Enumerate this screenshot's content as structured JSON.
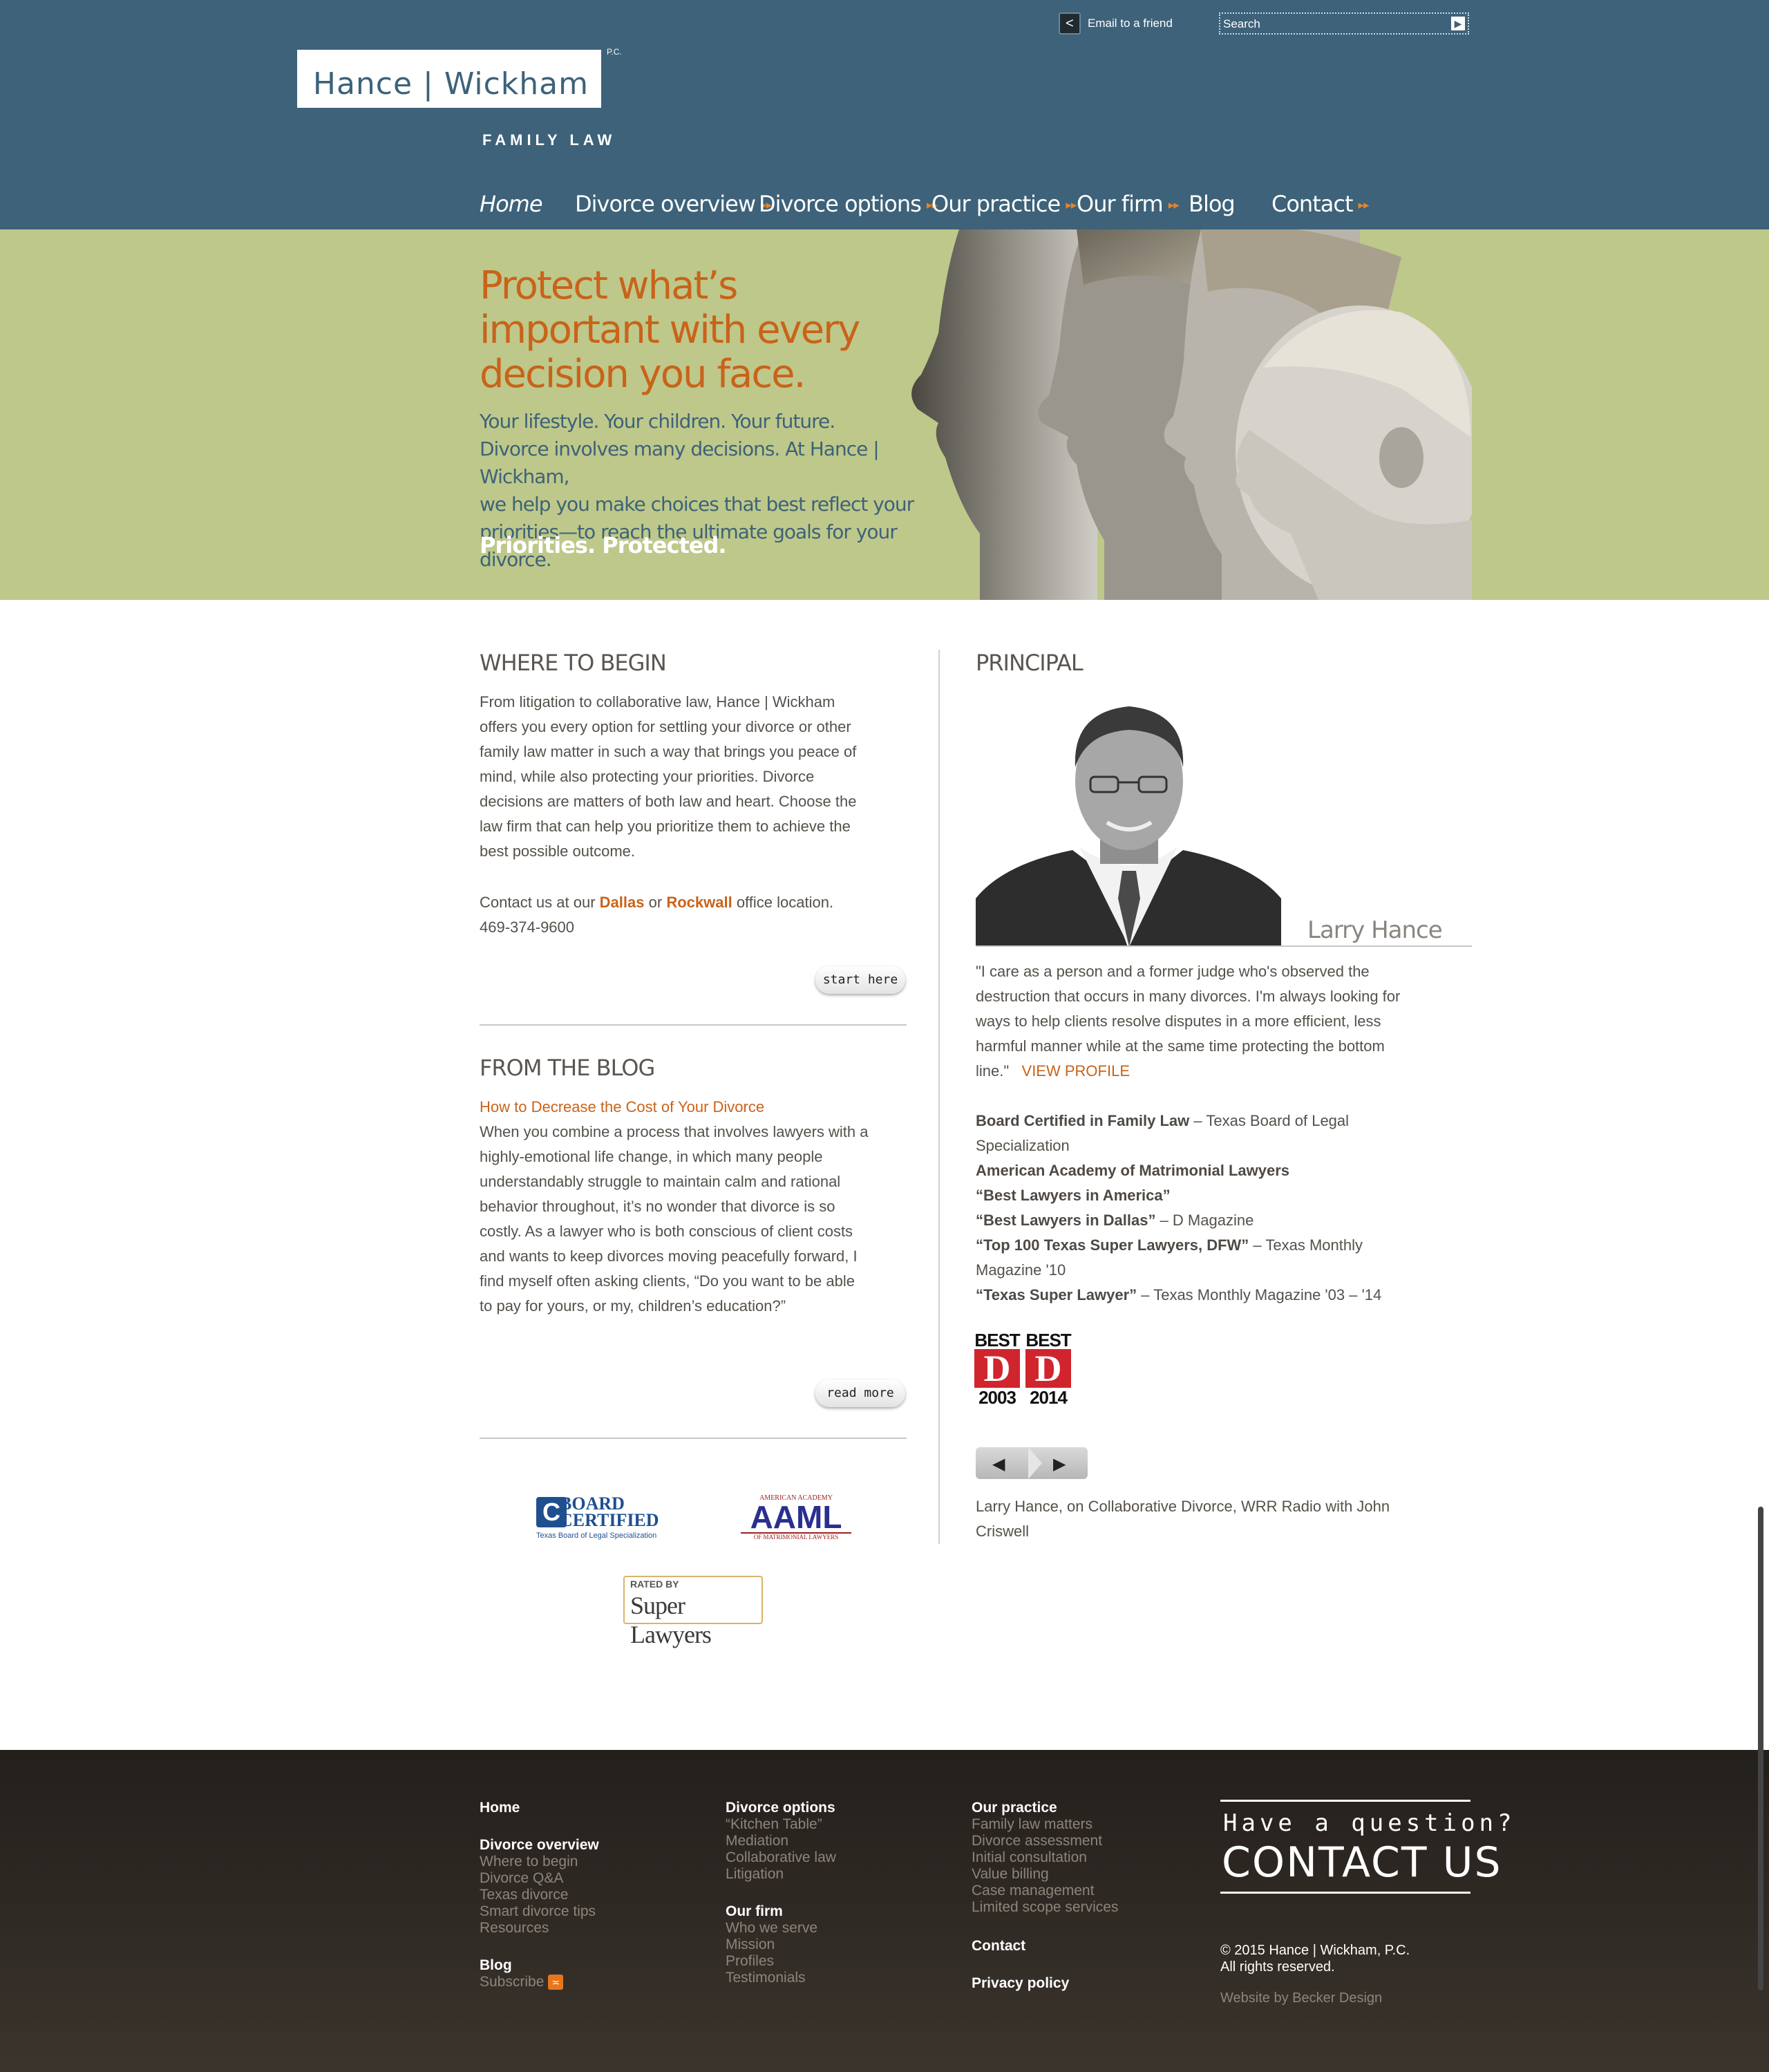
{
  "header": {
    "logo": {
      "name": "Hance | Wickham",
      "pc": "P.C.",
      "subtitle": "FAMILY LAW"
    },
    "email_friend": "Email to a friend",
    "search": {
      "placeholder": "Search"
    }
  },
  "nav": [
    {
      "label": "Home",
      "has_arrow": false
    },
    {
      "label": "Divorce overview",
      "has_arrow": true
    },
    {
      "label": "Divorce options",
      "has_arrow": true
    },
    {
      "label": "Our practice",
      "has_arrow": true
    },
    {
      "label": "Our firm",
      "has_arrow": true
    },
    {
      "label": "Blog",
      "has_arrow": false
    },
    {
      "label": "Contact",
      "has_arrow": true
    }
  ],
  "hero": {
    "headline": [
      "Protect what’s",
      "important with every",
      "decision you face."
    ],
    "body": [
      "Your lifestyle. Your children. Your future.",
      "Divorce involves many decisions. At Hance | Wickham,",
      "we help you make choices that best reflect your",
      "priorities—to reach the ultimate goals for your divorce."
    ],
    "tagline": "Priorities. Protected."
  },
  "where_to_begin": {
    "title": "WHERE TO BEGIN",
    "lines": [
      "From litigation to collaborative law, Hance | Wickham",
      "offers you every option for settling your divorce or other",
      "family law matter in such a way that brings you peace of",
      "mind, while also protecting your priorities. Divorce",
      "decisions are matters of both law and heart. Choose the",
      "law firm that can help you prioritize them to achieve the",
      "best possible outcome."
    ],
    "contact_prefix": "Contact us at our",
    "dallas": "Dallas",
    "or": "or",
    "rockwall": "Rockwall",
    "contact_suffix": "office location.",
    "phone": "469-374-9600",
    "button": "start here"
  },
  "from_the_blog": {
    "title": "FROM THE BLOG",
    "post_title": "How to Decrease the Cost of Your Divorce",
    "lines": [
      "When you combine a process that involves lawyers with a",
      "highly-emotional life change, in which many people",
      "understandably struggle to maintain calm and rational",
      "behavior throughout, it’s no wonder that divorce is so",
      "costly. As a lawyer who is both conscious of client costs",
      "and wants to keep divorces moving peacefully forward, I",
      "find myself often asking clients, “Do you want to be able",
      "to pay for yours, or my, children’s education?”"
    ],
    "button": "read more"
  },
  "badges": {
    "board_certified": {
      "line1": "BOARD",
      "line2": "CERTIFIED",
      "tag": "Texas Board of Legal Specialization"
    },
    "aaml": {
      "top": "AMERICAN ACADEMY",
      "main": "AAML",
      "bottom": "OF MATRIMONIAL LAWYERS"
    },
    "super_lawyers": {
      "rated": "RATED BY",
      "name": "Super Lawyers"
    }
  },
  "principal": {
    "title": "PRINCIPAL",
    "name": "Larry Hance",
    "quote_lines": [
      "\"I care as a person and a former judge who's observed the",
      "destruction that occurs in many divorces. I'm always looking for",
      "ways to help clients resolve disputes in a more efficient, less",
      "harmful manner while at the same time protecting the bottom"
    ],
    "quote_end": "line.\"",
    "view_profile": "VIEW PROFILE",
    "credentials": [
      {
        "bold": "Board Certified in Family Law",
        "rest": " – Texas Board of Legal"
      },
      {
        "bold": "",
        "rest": "Specialization"
      },
      {
        "bold": "American Academy of Matrimonial Lawyers",
        "rest": ""
      },
      {
        "bold": "“Best Lawyers in America”",
        "rest": ""
      },
      {
        "bold": "“Best Lawyers in Dallas”",
        "rest": " – D Magazine"
      },
      {
        "bold": "“Top 100 Texas Super Lawyers, DFW”",
        "rest": " – Texas Monthly"
      },
      {
        "bold": "",
        "rest": "Magazine '10"
      },
      {
        "bold": "“Texas Super Lawyer”",
        "rest": " – Texas Monthly Magazine '03 – '14"
      }
    ],
    "awards": [
      {
        "best": "BEST",
        "letter": "D",
        "year": "2003"
      },
      {
        "best": "BEST",
        "letter": "D",
        "year": "2014"
      }
    ],
    "media_caption": [
      "Larry Hance, on Collaborative Divorce, WRR Radio with John",
      "Criswell"
    ]
  },
  "footer": {
    "col1": {
      "home": "Home",
      "overview": "Divorce overview",
      "overview_links": [
        "Where to begin",
        "Divorce Q&A",
        "Texas divorce",
        "Smart divorce tips",
        "Resources"
      ],
      "blog": "Blog",
      "subscribe": "Subscribe"
    },
    "col2": {
      "options": "Divorce options",
      "options_links": [
        "“Kitchen Table”",
        "Mediation",
        "Collaborative law",
        "Litigation"
      ],
      "firm": "Our firm",
      "firm_links": [
        "Who we serve",
        "Mission",
        "Profiles",
        "Testimonials"
      ]
    },
    "col3": {
      "practice": "Our practice",
      "practice_links": [
        "Family law matters",
        "Divorce assessment",
        "Initial consultation",
        "Value billing",
        "Case management",
        "Limited scope services"
      ],
      "contact": "Contact",
      "privacy": "Privacy policy"
    },
    "cta": {
      "question": "Have a question?",
      "contact": "CONTACT US"
    },
    "copyright": [
      "© 2015 Hance | Wickham, P.C.",
      "All rights reserved."
    ],
    "credit": "Website by Becker Design"
  },
  "colors": {
    "header": "#3d6279",
    "hero": "#bec88a",
    "accent": "#c9631a",
    "footer": "#2a2520"
  }
}
